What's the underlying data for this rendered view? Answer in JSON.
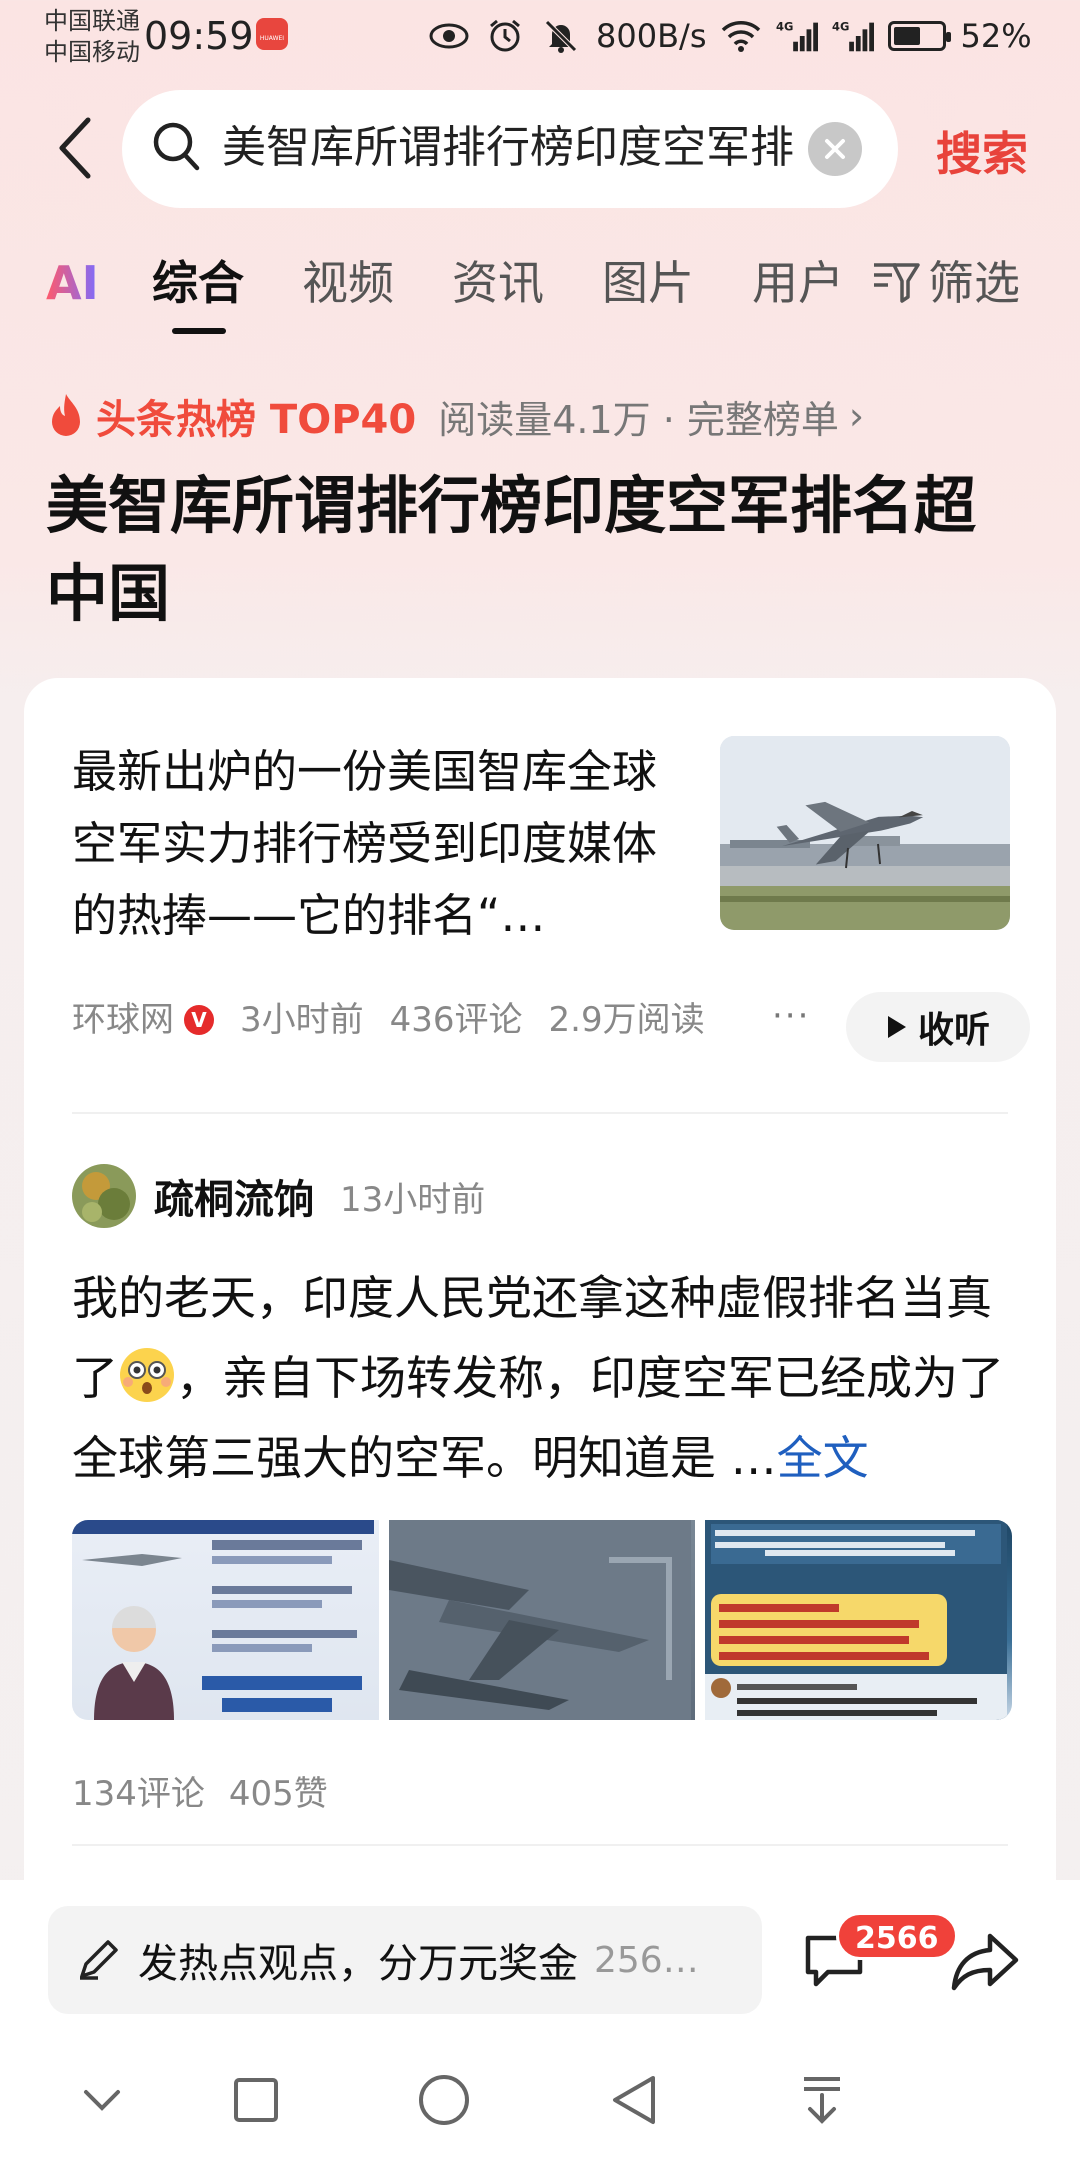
{
  "status": {
    "carrier1": "中国联通",
    "carrier2": "中国移动",
    "time": "09:59",
    "app_badge": "HUAWEI",
    "network_speed": "800B/s",
    "signal1": "4G",
    "signal2": "4G",
    "battery": "52%"
  },
  "search": {
    "query": "美智库所谓排行榜印度空军排",
    "submit_label": "搜索"
  },
  "tabs": [
    {
      "label": "AI"
    },
    {
      "label": "综合"
    },
    {
      "label": "视频"
    },
    {
      "label": "资讯"
    },
    {
      "label": "图片"
    },
    {
      "label": "用户"
    }
  ],
  "filter_label": "筛选",
  "hot": {
    "label": "头条热榜 TOP40",
    "meta": "阅读量4.1万 · 完整榜单",
    "title": "美智库所谓排行榜印度空军排名超中国"
  },
  "article": {
    "summary": "最新出炉的一份美国智库全球空军实力排行榜受到印度媒体的热捧——它的排名“…",
    "source": "环球网",
    "verified_mark": "V",
    "time": "3小时前",
    "comments": "436评论",
    "reads": "2.9万阅读",
    "more": "···",
    "collect_label": "收听"
  },
  "post": {
    "author": "疏桐流饷",
    "time": "13小时前",
    "text_before_emoji": "我的老天，印度人民党还拿这种虚假排名当真了",
    "text_after_emoji": "，亲自下场转发称，印度空军已经成为了全球第三强大的空军。明知道是 …",
    "full_link": "全文",
    "comments": "134评论",
    "likes": "405赞"
  },
  "bottom": {
    "input_text": "发热点观点，分万元奖金",
    "input_count": "256…",
    "comment_badge": "2566"
  }
}
